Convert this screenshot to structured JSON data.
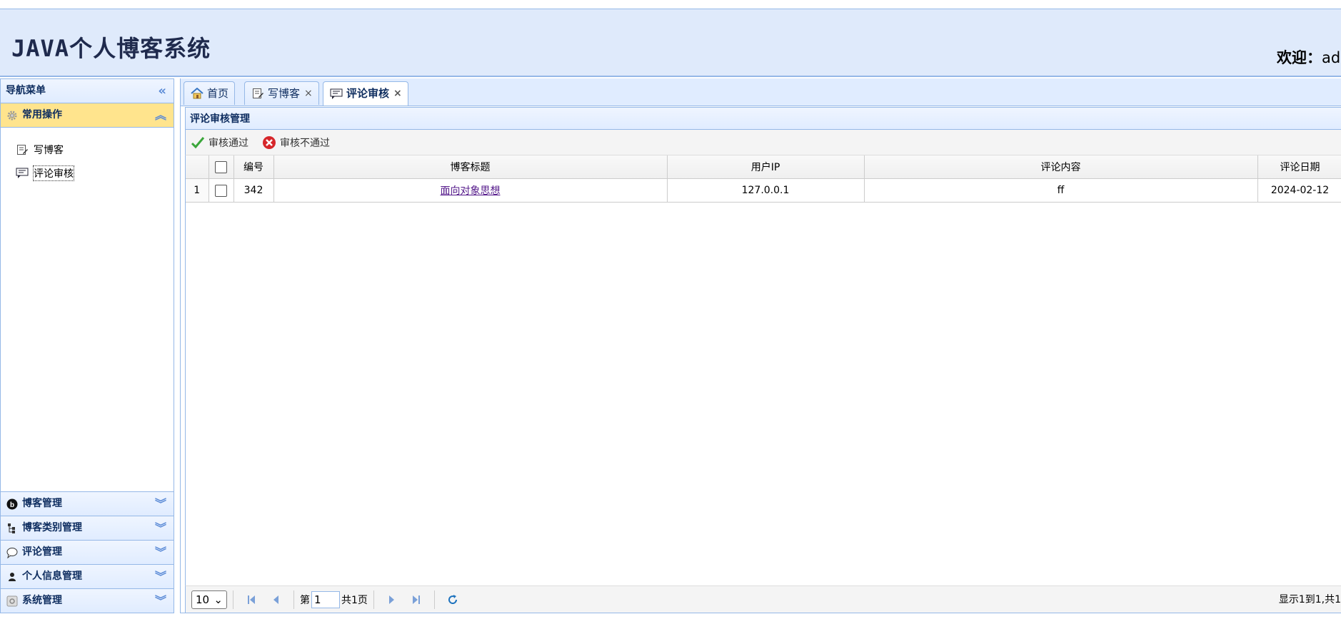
{
  "header": {
    "app_title": "JAVA个人博客系统",
    "welcome_label": "欢迎：",
    "welcome_user": "adr"
  },
  "nav": {
    "title": "导航菜单",
    "sections": [
      {
        "label": "常用操作",
        "icon": "gear-icon",
        "expanded": true
      },
      {
        "label": "博客管理",
        "icon": "blog-icon"
      },
      {
        "label": "博客类别管理",
        "icon": "tree-icon"
      },
      {
        "label": "评论管理",
        "icon": "comment-icon"
      },
      {
        "label": "个人信息管理",
        "icon": "user-icon"
      },
      {
        "label": "系统管理",
        "icon": "settings-icon"
      }
    ],
    "common_items": [
      {
        "label": "写博客",
        "icon": "edit-icon"
      },
      {
        "label": "评论审核",
        "icon": "review-icon"
      }
    ]
  },
  "tabs": [
    {
      "label": "首页",
      "icon": "home-icon",
      "closable": false
    },
    {
      "label": "写博客",
      "icon": "edit-icon",
      "closable": true
    },
    {
      "label": "评论审核",
      "icon": "review-icon",
      "closable": true,
      "active": true
    }
  ],
  "panel": {
    "title": "评论审核管理",
    "toolbar": {
      "approve_label": "审核通过",
      "reject_label": "审核不通过"
    }
  },
  "table": {
    "columns": [
      "编号",
      "博客标题",
      "用户IP",
      "评论内容",
      "评论日期"
    ],
    "rows": [
      {
        "rownum": "1",
        "id": "342",
        "blog_title": "面向对象思想",
        "user_ip": "127.0.0.1",
        "content": "ff",
        "date": "2024-02-12"
      }
    ]
  },
  "pager": {
    "page_size": "10",
    "page_prefix": "第",
    "page_value": "1",
    "page_total": "共1页",
    "info": "显示1到1,共1"
  },
  "colors": {
    "header_bg": "#dfeafb",
    "border": "#95b8e7",
    "selected_section": "#ffe48d",
    "link_visited": "#551a8b"
  }
}
